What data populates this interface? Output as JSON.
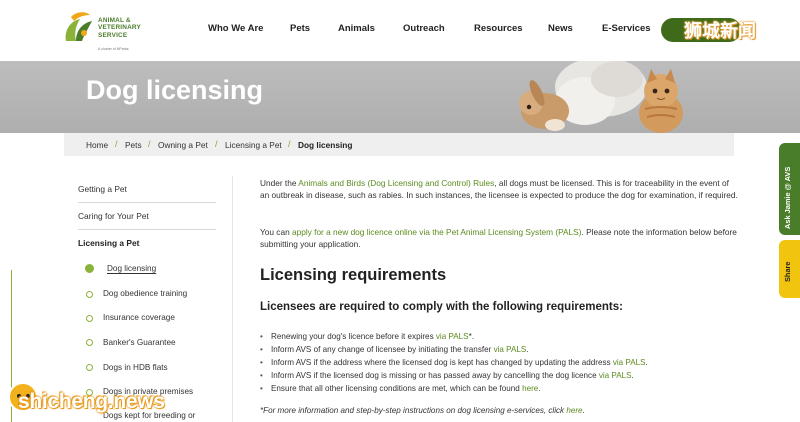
{
  "header": {
    "logo": {
      "line1": "ANIMAL &",
      "line2": "VETERINARY",
      "line3": "SERVICE",
      "tagline": "A cluster of NParks"
    },
    "nav": [
      {
        "label": "Who We Are"
      },
      {
        "label": "Pets"
      },
      {
        "label": "Animals"
      },
      {
        "label": "Outreach"
      },
      {
        "label": "Resources"
      },
      {
        "label": "News"
      },
      {
        "label": "E-Services"
      }
    ],
    "button_label": "",
    "watermark_cn": "狮城新闻"
  },
  "hero": {
    "title": "Dog licensing"
  },
  "breadcrumb": [
    {
      "label": "Home"
    },
    {
      "label": "Pets"
    },
    {
      "label": "Owning a Pet"
    },
    {
      "label": "Licensing a Pet"
    },
    {
      "label": "Dog licensing",
      "current": true
    }
  ],
  "sidebar": {
    "items": [
      {
        "label": "Getting a Pet"
      },
      {
        "label": "Caring for Your Pet"
      },
      {
        "label": "Licensing a Pet"
      }
    ],
    "sub_items": [
      {
        "label": "Dog licensing",
        "active": true
      },
      {
        "label": "Dog obedience training"
      },
      {
        "label": "Insurance coverage"
      },
      {
        "label": "Banker's Guarantee"
      },
      {
        "label": "Dogs in HDB flats"
      },
      {
        "label": "Dogs in private premises"
      },
      {
        "label": "Dogs kept for breeding or"
      }
    ]
  },
  "content": {
    "intro": {
      "pre": "Under the ",
      "link": "Animals and Birds (Dog Licensing and Control) Rules",
      "post": ", all dogs must be licensed. This is for traceability in the event of an outbreak in disease, such as rabies. In such instances, the licensee is expected to produce the dog for examination, if required."
    },
    "apply": {
      "pre": "You can ",
      "link": "apply for a new dog licence online via the Pet Animal Licensing System (PALS)",
      "post": ". Please note the information below before submitting your application."
    },
    "heading": "Licensing requirements",
    "subheading": "Licensees are required to comply with the following requirements:",
    "bullets": [
      {
        "pre": "Renewing your dog's licence before it expires ",
        "link": "via PALS",
        "post": "*."
      },
      {
        "pre": "Inform AVS of any change of licensee by initiating the transfer ",
        "link": "via PALS",
        "post": "."
      },
      {
        "pre": "Inform AVS if the address where the licensed dog is kept has changed by updating the address ",
        "link": "via PALS",
        "post": "."
      },
      {
        "pre": "Inform AVS if the licensed dog is missing or has passed away by cancelling the dog licence ",
        "link": "via PALS",
        "post": "."
      },
      {
        "pre": "Ensure that all other licensing conditions are met, which can be found ",
        "link": "here",
        "post": "."
      }
    ],
    "note": {
      "pre": "*For more information and step-by-step instructions on dog licensing e-services, click ",
      "link": "here",
      "post": "."
    }
  },
  "side_tabs": {
    "ask": "Ask Jamie @ AVS",
    "share": "Share"
  },
  "watermark_bottom": "shicheng.news",
  "colors": {
    "brand_green": "#4a7d2a",
    "link_green": "#5c8a1e",
    "share_yellow": "#f1c40f"
  }
}
